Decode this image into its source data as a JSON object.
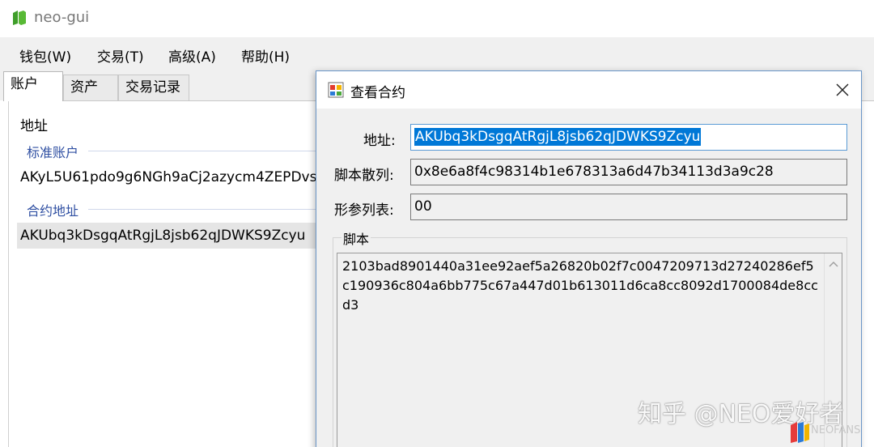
{
  "window": {
    "title": "neo-gui"
  },
  "menu": [
    {
      "label": "钱包(W)"
    },
    {
      "label": "交易(T)"
    },
    {
      "label": "高级(A)"
    },
    {
      "label": "帮助(H)"
    }
  ],
  "tabs": [
    {
      "label": "账户",
      "active": true
    },
    {
      "label": "资产",
      "active": false
    },
    {
      "label": "交易记录",
      "active": false
    }
  ],
  "accounts": {
    "column_header": "地址",
    "groups": [
      {
        "label": "标准账户",
        "rows": [
          "AKyL5U61pdo9g6NGh9aCj2azycm4ZEPDvs"
        ]
      },
      {
        "label": "合约地址",
        "rows": [
          "AKUbq3kDsgqAtRgjL8jsb62qJDWKS9Zcyu"
        ]
      }
    ]
  },
  "dialog": {
    "title": "查看合约",
    "address_label": "地址:",
    "address_value": "AKUbq3kDsgqAtRgjL8jsb62qJDWKS9Zcyu",
    "script_hash_label": "脚本散列:",
    "script_hash_value": "0x8e6a8f4c98314b1e678313a6d47b34113d3a9c28",
    "params_label": "形参列表:",
    "params_value": "00",
    "script_group_label": "脚本",
    "script_value": "2103bad8901440a31ee92aef5a26820b02f7c0047209713d27240286ef5c190936c804a6bb775c67a447d01b613011d6ca8cc8092d1700084de8ccd3"
  },
  "watermark": {
    "text": "知乎 @NEO爱好者",
    "sub": "NEOFANS"
  },
  "colors": {
    "accent": "#0078d7",
    "group_label": "#2f4fa2",
    "logo_green": "#58b935"
  }
}
